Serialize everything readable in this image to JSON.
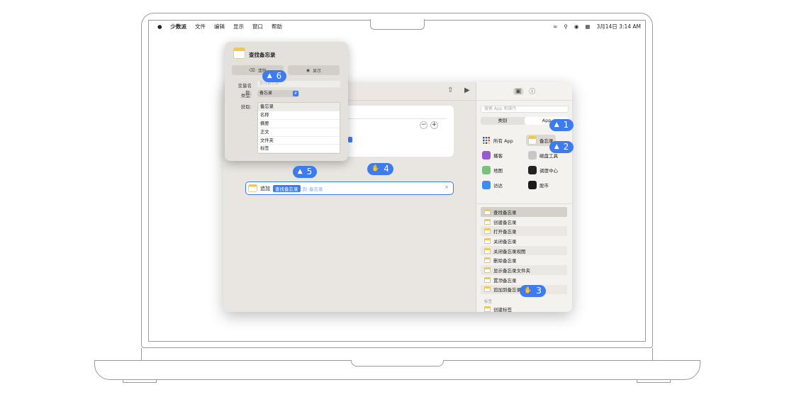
{
  "menubar": {
    "apple": "",
    "items": [
      "少数派",
      "文件",
      "编辑",
      "显示",
      "窗口",
      "帮助"
    ],
    "datetime": "3月14日 3:14 AM"
  },
  "popover": {
    "title": "查找备忘录",
    "clear_button": "清除",
    "show_button": "显示",
    "labels": {
      "var_name": "变量名称:",
      "type": "类型:",
      "get": "获取:"
    },
    "var_name_placeholder": "查找备忘录",
    "type_value": "备忘录",
    "get_options": [
      "备忘录",
      "名称",
      "摘要",
      "正文",
      "文件夹",
      "标签"
    ]
  },
  "editor": {
    "action_verb": "追加",
    "token_label": "查找备忘录",
    "token_ghost_1": "到",
    "token_ghost_2": "备忘录"
  },
  "sidebar": {
    "search_placeholder": "搜索 App 和操作",
    "segments": [
      "类别",
      "App"
    ],
    "apps": [
      {
        "label": "所有 App",
        "icon": "all-apps-icon",
        "color": "#555555"
      },
      {
        "label": "备忘录",
        "icon": "notes-icon",
        "color": "#f2c94c"
      },
      {
        "label": "播客",
        "icon": "podcasts-icon",
        "color": "#9b59d0"
      },
      {
        "label": "磁盘工具",
        "icon": "disk-utility-icon",
        "color": "#8a8a8a"
      },
      {
        "label": "地图",
        "icon": "maps-icon",
        "color": "#4caf50"
      },
      {
        "label": "调度中心",
        "icon": "mission-control-icon",
        "color": "#222222"
      },
      {
        "label": "访达",
        "icon": "finder-icon",
        "color": "#3d8cf0"
      },
      {
        "label": "股市",
        "icon": "stocks-icon",
        "color": "#1b1b1b"
      }
    ],
    "actions": [
      "查找备忘录",
      "创建备忘录",
      "打开备忘录",
      "关闭备忘录",
      "关闭备忘录视图",
      "删除备忘录",
      "显示备忘录文件夹",
      "置顶备忘录",
      "追加到备忘录"
    ],
    "section_label": "标签",
    "next_action": "创建标签"
  },
  "badges": [
    "1",
    "2",
    "3",
    "4",
    "5",
    "6"
  ],
  "colors": {
    "accent": "#3d7cf0",
    "notes_yellow": "#f2c94c"
  }
}
